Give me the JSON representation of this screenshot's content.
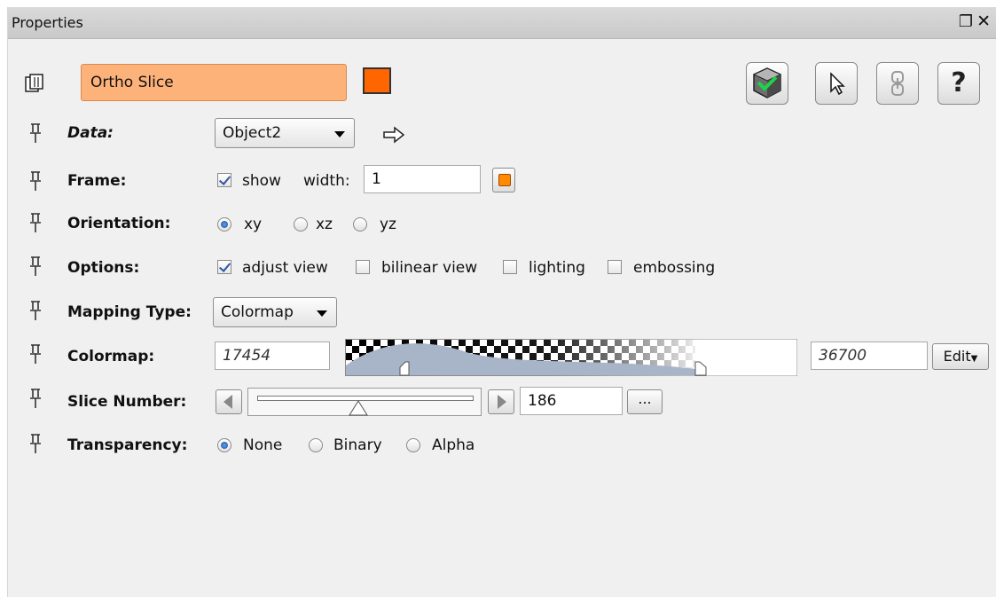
{
  "titlebar": {
    "title": "Properties",
    "float_icon": "restore-window-icon",
    "close_icon": "close-icon"
  },
  "header": {
    "module_name": "Ortho Slice",
    "module_color": "#ff6600",
    "name_field_color": "#fdb27a",
    "toolbar_icons": [
      "cube-visibility-icon",
      "cursor-icon",
      "connection-icon",
      "help-icon"
    ],
    "help_text": "?"
  },
  "rows": {
    "data": {
      "label": "Data:",
      "value": "Object2",
      "arrow_icon": "right-arrow-icon"
    },
    "frame": {
      "label": "Frame:",
      "show_label": "show",
      "show_checked": true,
      "width_label": "width:",
      "width_value": "1",
      "frame_color": "#ff8a00"
    },
    "orientation": {
      "label": "Orientation:",
      "options": [
        "xy",
        "xz",
        "yz"
      ],
      "selected": "xy"
    },
    "options": {
      "label": "Options:",
      "items": [
        {
          "label": "adjust view",
          "checked": true
        },
        {
          "label": "bilinear view",
          "checked": false
        },
        {
          "label": "lighting",
          "checked": false
        },
        {
          "label": "embossing",
          "checked": false
        }
      ]
    },
    "mapping": {
      "label": "Mapping Type:",
      "value": "Colormap"
    },
    "colormap": {
      "label": "Colormap:",
      "min": "17454",
      "max": "36700",
      "edit_label": "Edit"
    },
    "slice": {
      "label": "Slice Number:",
      "value": "186",
      "more_label": "...",
      "position": 0.47
    },
    "transparency": {
      "label": "Transparency:",
      "options": [
        "None",
        "Binary",
        "Alpha"
      ],
      "selected": "None"
    }
  }
}
